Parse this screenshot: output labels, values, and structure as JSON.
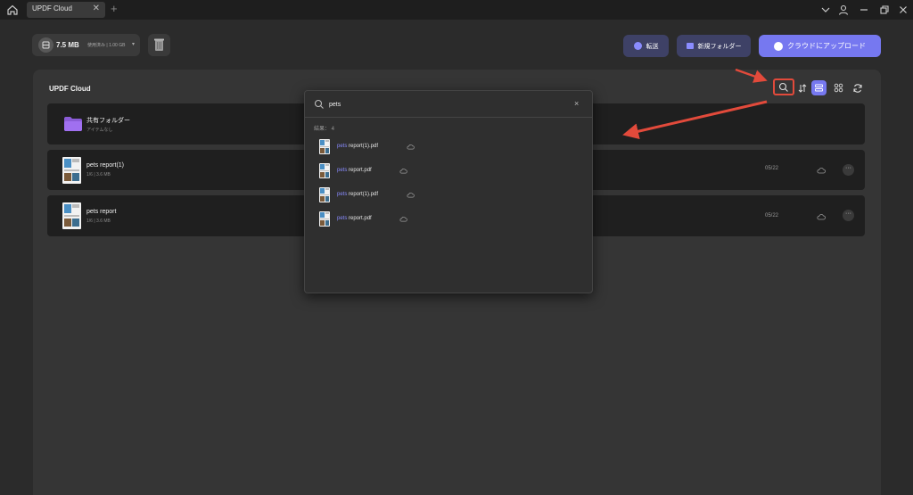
{
  "window": {
    "tab_title": "UPDF Cloud",
    "tab_close": "✕",
    "tab_add": "+"
  },
  "storage": {
    "used": "7.5 MB",
    "total": "使用済み | 1.00 GB"
  },
  "toolbar": {
    "transfer_label": "転送",
    "new_folder_label": "新規フォルダー",
    "upload_label": "クラウドにアップロード"
  },
  "panel": {
    "title": "UPDF Cloud"
  },
  "files": [
    {
      "name": "共有フォルダー",
      "meta": "アイテムなし",
      "type": "folder"
    },
    {
      "name": "pets report(1)",
      "meta": "1/6 | 3.6 MB",
      "date": "05/22",
      "type": "pdf"
    },
    {
      "name": "pets report",
      "meta": "1/6 | 3.6 MB",
      "date": "05/22",
      "type": "pdf"
    }
  ],
  "search": {
    "query": "pets",
    "clear": "×",
    "result_count_label": "結果： 4",
    "results": [
      {
        "match": "pets",
        "rest": " report(1).pdf"
      },
      {
        "match": "pets",
        "rest": " report.pdf"
      },
      {
        "match": "pets",
        "rest": " report(1).pdf"
      },
      {
        "match": "pets",
        "rest": " report.pdf"
      }
    ]
  },
  "colors": {
    "accent": "#7678f0",
    "annotation_red": "#e24a3b",
    "row_bg": "#1f1f1f"
  }
}
